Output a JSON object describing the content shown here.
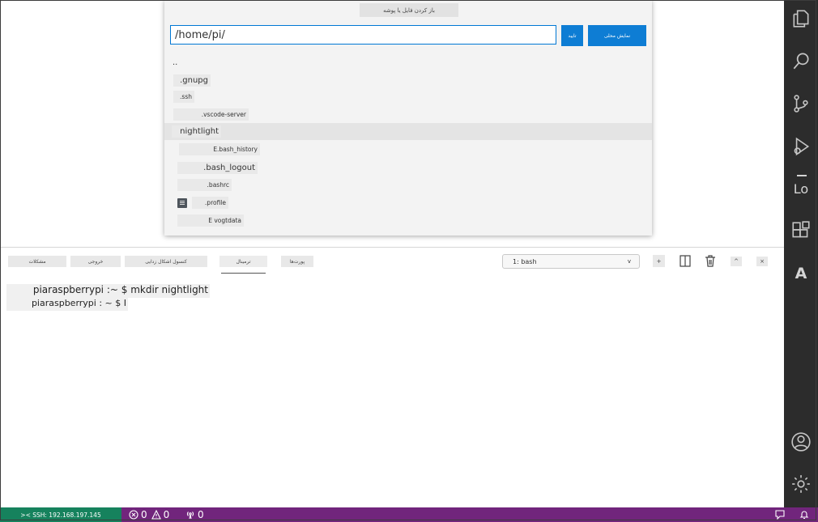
{
  "quickpick": {
    "title": "باز کردن فایل یا پوشه",
    "path_value": "/home/pi/",
    "ok_label": "تایید",
    "local_label": "نمایش محلی",
    "items": [
      {
        "label": ".."
      },
      {
        "label": ".gnupg"
      },
      {
        "label": ".ssh"
      },
      {
        "label": ".vscode-server"
      },
      {
        "label": "nightlight"
      },
      {
        "label": "E.bash_history"
      },
      {
        "label": ".bash_logout"
      },
      {
        "label": ".bashrc"
      },
      {
        "label": ".profile"
      },
      {
        "label": "E vogtdata"
      }
    ]
  },
  "panel": {
    "tabs": [
      {
        "label": "مشکلات"
      },
      {
        "label": "خروجی"
      },
      {
        "label": "کنسول اشکال زدایی"
      },
      {
        "label": "ترمینال"
      },
      {
        "label": "پورت‌ها"
      }
    ],
    "terminal_select": "1: bash",
    "add_label": "+",
    "max_label": "^",
    "close_label": "×"
  },
  "terminal": {
    "lines": [
      "piaraspberrypi :~ $ mkdir nightlight",
      "piaraspberrypi : ~ $ I"
    ]
  },
  "activity_bar": {
    "lo_label": "Lo",
    "a_label": "A"
  },
  "statusbar": {
    "remote": ">< SSH: 192.168.197.145",
    "errors": "0",
    "warnings": "0",
    "ports": "0"
  },
  "colors": {
    "statusbar": "#71257c",
    "remote": "#16825d",
    "accent": "#0e7dd4",
    "activity_bar": "#2c2c2c"
  }
}
